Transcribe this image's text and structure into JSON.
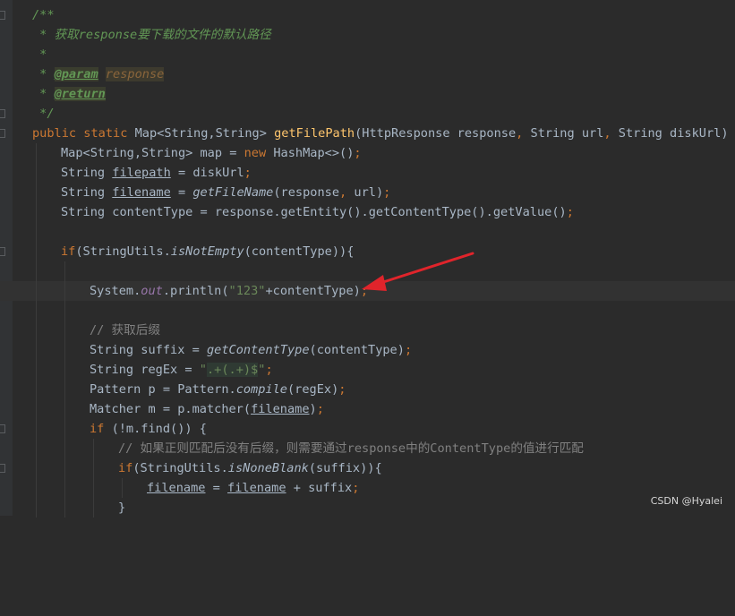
{
  "watermark": "CSDN @Hyalei",
  "code": {
    "l1": {
      "a": "/**"
    },
    "l2": {
      "a": " * 获取response要下载的文件的默认路径"
    },
    "l3": {
      "a": " *"
    },
    "l4": {
      "a": " * ",
      "b": "@param",
      "c": " ",
      "d": "response"
    },
    "l5": {
      "a": " * ",
      "b": "@return"
    },
    "l6": {
      "a": " */"
    },
    "l7": {
      "a": "public static ",
      "b": "Map<String,String> ",
      "c": "getFilePath",
      "d": "(HttpResponse response",
      "e": ", ",
      "f": "String url",
      "g": ", ",
      "h": "String diskUrl) {"
    },
    "l8": {
      "a": "Map<String,String> map = ",
      "b": "new ",
      "c": "HashMap<>()",
      "d": ";"
    },
    "l9": {
      "a": "String ",
      "b": "filepath",
      "c": " = diskUrl",
      "d": ";"
    },
    "l10": {
      "a": "String ",
      "b": "filename",
      "c": " = ",
      "d": "getFileName",
      "e": "(response",
      "f": ", ",
      "g": "url)",
      "h": ";"
    },
    "l11": {
      "a": "String contentType = response.getEntity().getContentType().getValue()",
      "b": ";"
    },
    "l13": {
      "a": "if",
      "b": "(StringUtils.",
      "c": "isNotEmpty",
      "d": "(contentType)){"
    },
    "l15": {
      "a": "System.",
      "b": "out",
      "c": ".println(",
      "d": "\"123\"",
      "e": "+contentType)",
      "f": ";"
    },
    "l17": {
      "a": "// 获取后缀"
    },
    "l18": {
      "a": "String suffix = ",
      "b": "getContentType",
      "c": "(contentType)",
      "d": ";"
    },
    "l19": {
      "a": "String regEx = ",
      "b": "\"",
      "c": ".+(.+)$",
      "d": "\"",
      "e": ";"
    },
    "l20": {
      "a": "Pattern p = Pattern.",
      "b": "compile",
      "c": "(regEx)",
      "d": ";"
    },
    "l21": {
      "a": "Matcher m = p.matcher(",
      "b": "filename",
      "c": ")",
      "d": ";"
    },
    "l22": {
      "a": "if ",
      "b": "(!m.find()) {"
    },
    "l23": {
      "a": "// 如果正则匹配后没有后缀，则需要通过response中的ContentType的值进行匹配"
    },
    "l24": {
      "a": "if",
      "b": "(StringUtils.",
      "c": "isNoneBlank",
      "d": "(suffix)){"
    },
    "l25": {
      "a": "filename",
      "b": " = ",
      "c": "filename",
      "d": " + suffix",
      "e": ";"
    },
    "l26": {
      "a": "}"
    }
  },
  "colors": {
    "background": "#2b2b2b",
    "keyword": "#cc7832",
    "method": "#ffc66d",
    "string": "#6a8759",
    "doc": "#629755",
    "field": "#9876aa",
    "comment": "#808080",
    "arrow": "#e0242b"
  }
}
